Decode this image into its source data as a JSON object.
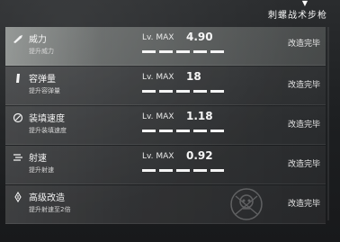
{
  "header": {
    "weapon_name": "刺螺战术步枪"
  },
  "upgrades": [
    {
      "name": "威力",
      "desc": "提升威力",
      "level_label": "Lv. MAX",
      "value": "4.90",
      "status": "改造完毕",
      "icon": "gun-power-icon",
      "level_bars_filled": 5
    },
    {
      "name": "容弹量",
      "desc": "提升容弹量",
      "level_label": "Lv. MAX",
      "value": "18",
      "status": "改造完毕",
      "icon": "ammo-magazine-icon",
      "level_bars_filled": 5
    },
    {
      "name": "装填速度",
      "desc": "提升装填速度",
      "level_label": "Lv. MAX",
      "value": "1.18",
      "status": "改造完毕",
      "icon": "reload-icon",
      "level_bars_filled": 5
    },
    {
      "name": "射速",
      "desc": "提升射速",
      "level_label": "Lv. MAX",
      "value": "0.92",
      "status": "改造完毕",
      "icon": "fire-rate-icon",
      "level_bars_filled": 5
    },
    {
      "name": "高级改造",
      "desc": "提升射速至2倍",
      "status": "改造完毕",
      "icon": "advanced-upgrade-icon",
      "emblem": "skull-stamp-icon"
    }
  ]
}
